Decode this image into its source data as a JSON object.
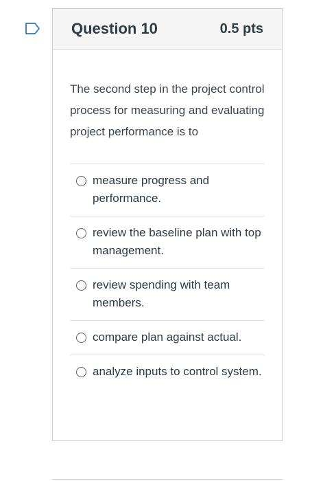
{
  "question": {
    "flag_icon": "flag-outline-icon",
    "title": "Question 10",
    "points": "0.5 pts",
    "text": "The second step in the project control process for measuring and evaluating project performance is to",
    "answers": [
      {
        "label": "measure progress and performance."
      },
      {
        "label": "review the baseline plan with top management."
      },
      {
        "label": "review spending with team members."
      },
      {
        "label": "compare plan against actual."
      },
      {
        "label": "analyze inputs to control system."
      }
    ]
  },
  "colors": {
    "accent": "#2b7abc",
    "header_bg": "#f5f5f5",
    "border": "#c7cdd1"
  }
}
